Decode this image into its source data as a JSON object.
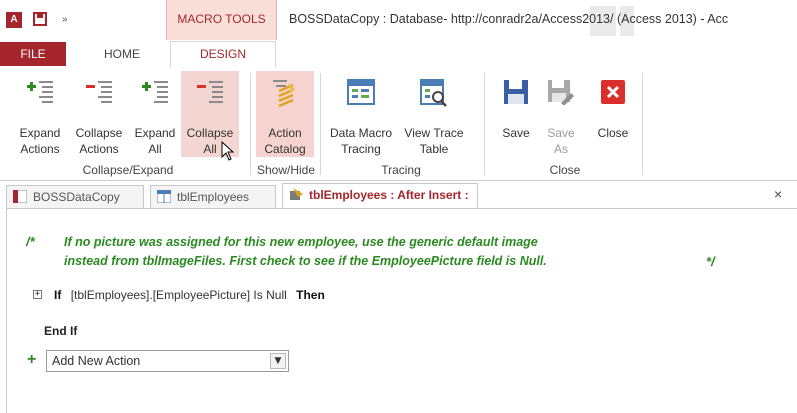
{
  "quick_access": {
    "app_icon_text": "A",
    "more_glyph": "»"
  },
  "contextual_tab_group": "MACRO TOOLS",
  "window_title": "BOSSDataCopy : Database- http://conradr2a/Access2013/ (Access 2013) - Acc",
  "tabs": {
    "file": "FILE",
    "home": "HOME",
    "design": "DESIGN"
  },
  "ribbon": {
    "groups": {
      "collapse_expand": "Collapse/Expand",
      "show_hide": "Show/Hide",
      "tracing": "Tracing",
      "close": "Close"
    },
    "buttons": {
      "expand_actions": {
        "line1": "Expand",
        "line2": "Actions"
      },
      "collapse_actions": {
        "line1": "Collapse",
        "line2": "Actions"
      },
      "expand_all": {
        "line1": "Expand",
        "line2": "All"
      },
      "collapse_all": {
        "line1": "Collapse",
        "line2": "All"
      },
      "action_catalog": {
        "line1": "Action",
        "line2": "Catalog"
      },
      "data_macro_tracing": {
        "line1": "Data Macro",
        "line2": "Tracing"
      },
      "view_trace_table": {
        "line1": "View Trace",
        "line2": "Table"
      },
      "save": {
        "line1": "Save",
        "line2": ""
      },
      "save_as": {
        "line1": "Save",
        "line2": "As"
      },
      "close": {
        "line1": "Close",
        "line2": ""
      }
    }
  },
  "document_tabs": [
    {
      "label": "BOSSDataCopy",
      "active": false
    },
    {
      "label": "tblEmployees",
      "active": false
    },
    {
      "label": "tblEmployees : After Insert :",
      "active": true
    }
  ],
  "document_close_glyph": "×",
  "macro": {
    "comment_open": "/*",
    "comment_line1": "If no picture was assigned for this new employee, use the generic default image",
    "comment_line2": "instead from tblImageFiles. First check to see if the EmployeePicture field is Null.",
    "comment_close": "*/",
    "expander_glyph": "+",
    "if_keyword": "If",
    "condition": "[tblEmployees].[EmployeePicture] Is Null",
    "then_keyword": "Then",
    "end_if": "End If",
    "add_plus": "+",
    "add_new_action": "Add New Action",
    "dropdown_glyph": "▼"
  },
  "colors": {
    "accent": "#a4262c",
    "comment_green": "#2b8a21",
    "contextual_band": "#fadfd9"
  },
  "icons": [
    "access-app-icon",
    "save-icon",
    "expand-actions-icon",
    "collapse-actions-icon",
    "expand-all-icon",
    "collapse-all-icon",
    "action-catalog-icon",
    "data-macro-tracing-icon",
    "view-trace-table-icon",
    "save-large-icon",
    "save-as-icon",
    "close-red-icon",
    "mouse-cursor-icon"
  ]
}
